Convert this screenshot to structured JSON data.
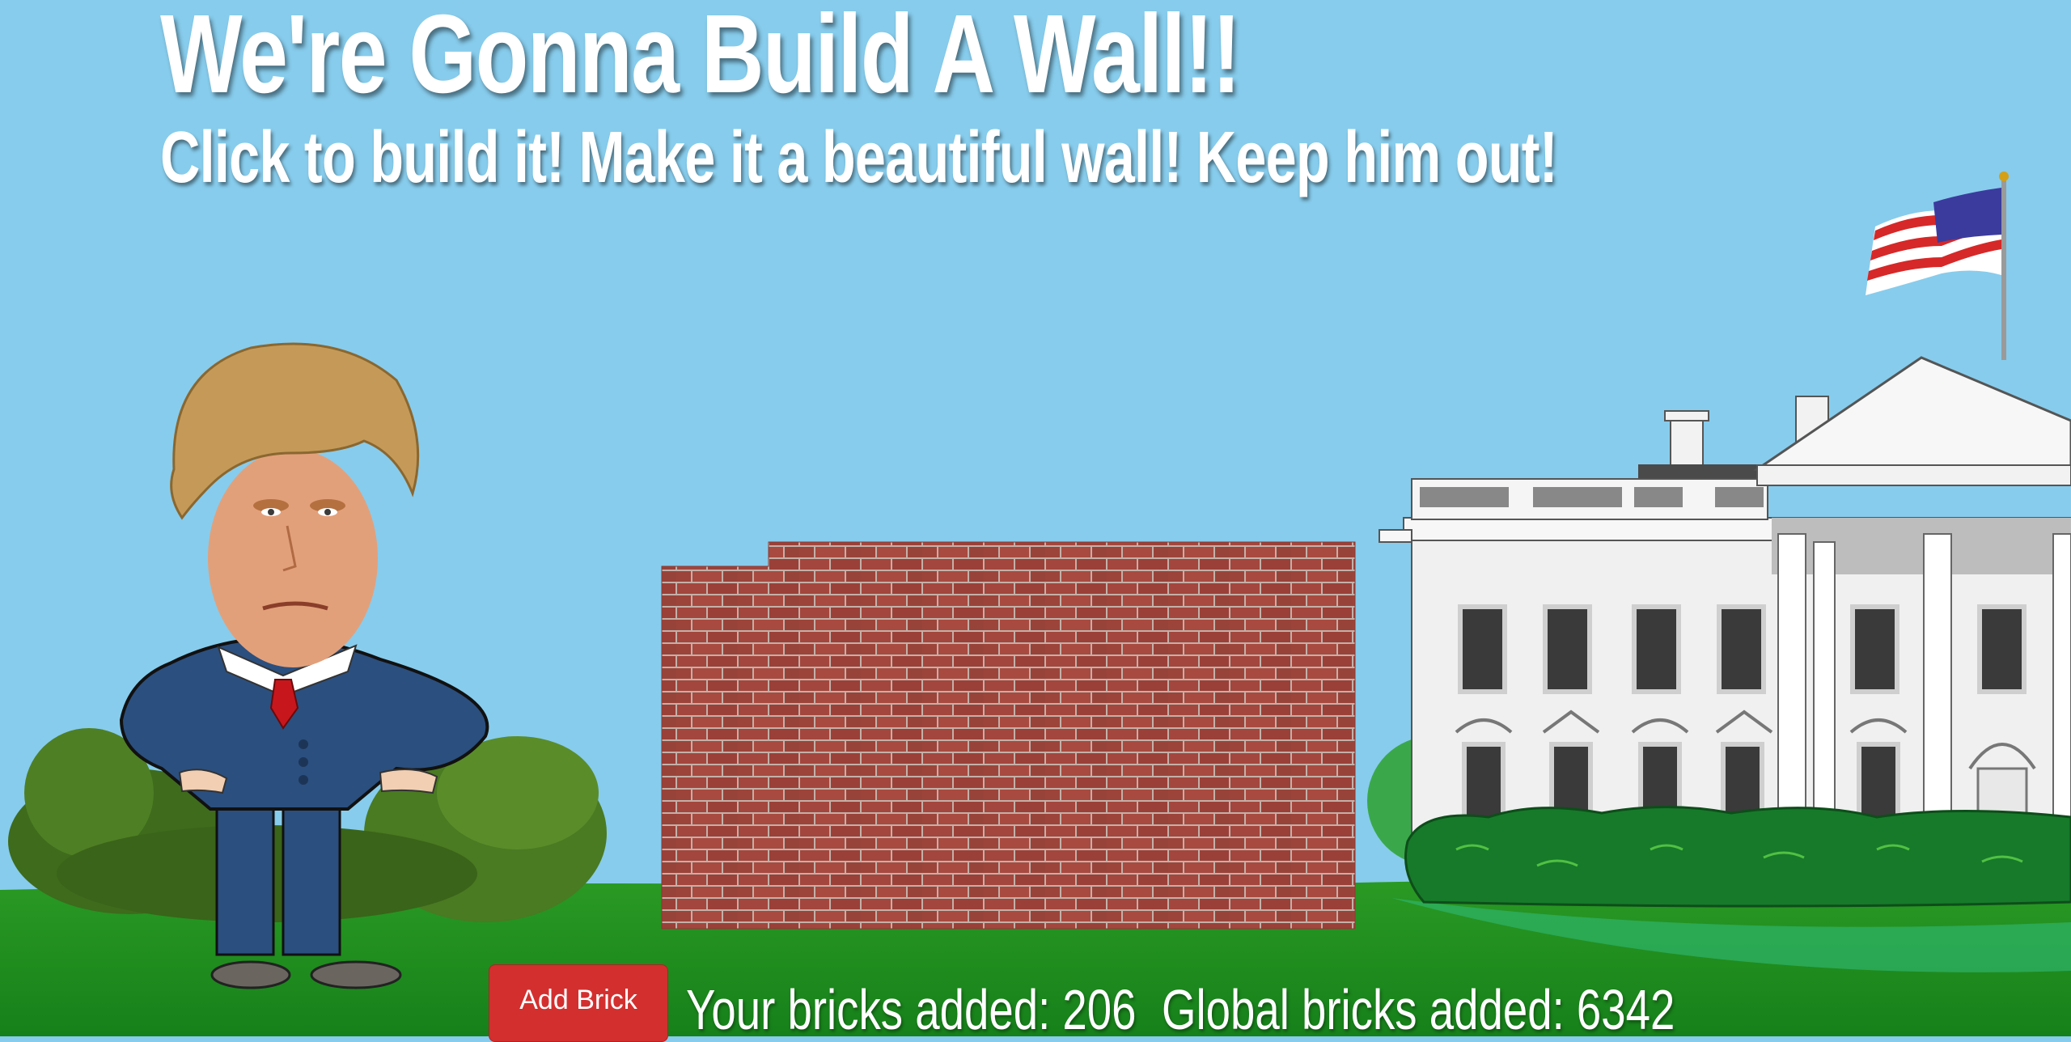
{
  "header": {
    "title": "We're Gonna Build A Wall!!",
    "subtitle": "Click to build it! Make it a beautiful wall! Keep him out!"
  },
  "controls": {
    "add_brick_label": "Add Brick"
  },
  "stats": {
    "your_bricks_text": "Your bricks added: 206",
    "global_bricks_text": "Global bricks added: 6342",
    "your_bricks": 206,
    "global_bricks": 6342
  },
  "colors": {
    "sky": "#87ccec",
    "grass": "#1f8a1c",
    "brick": "#a3463d",
    "mortar": "#c9b5ad",
    "button": "#d32f2f",
    "suit": "#2b4f7e"
  },
  "icons": {
    "flag": "us-flag-icon"
  }
}
